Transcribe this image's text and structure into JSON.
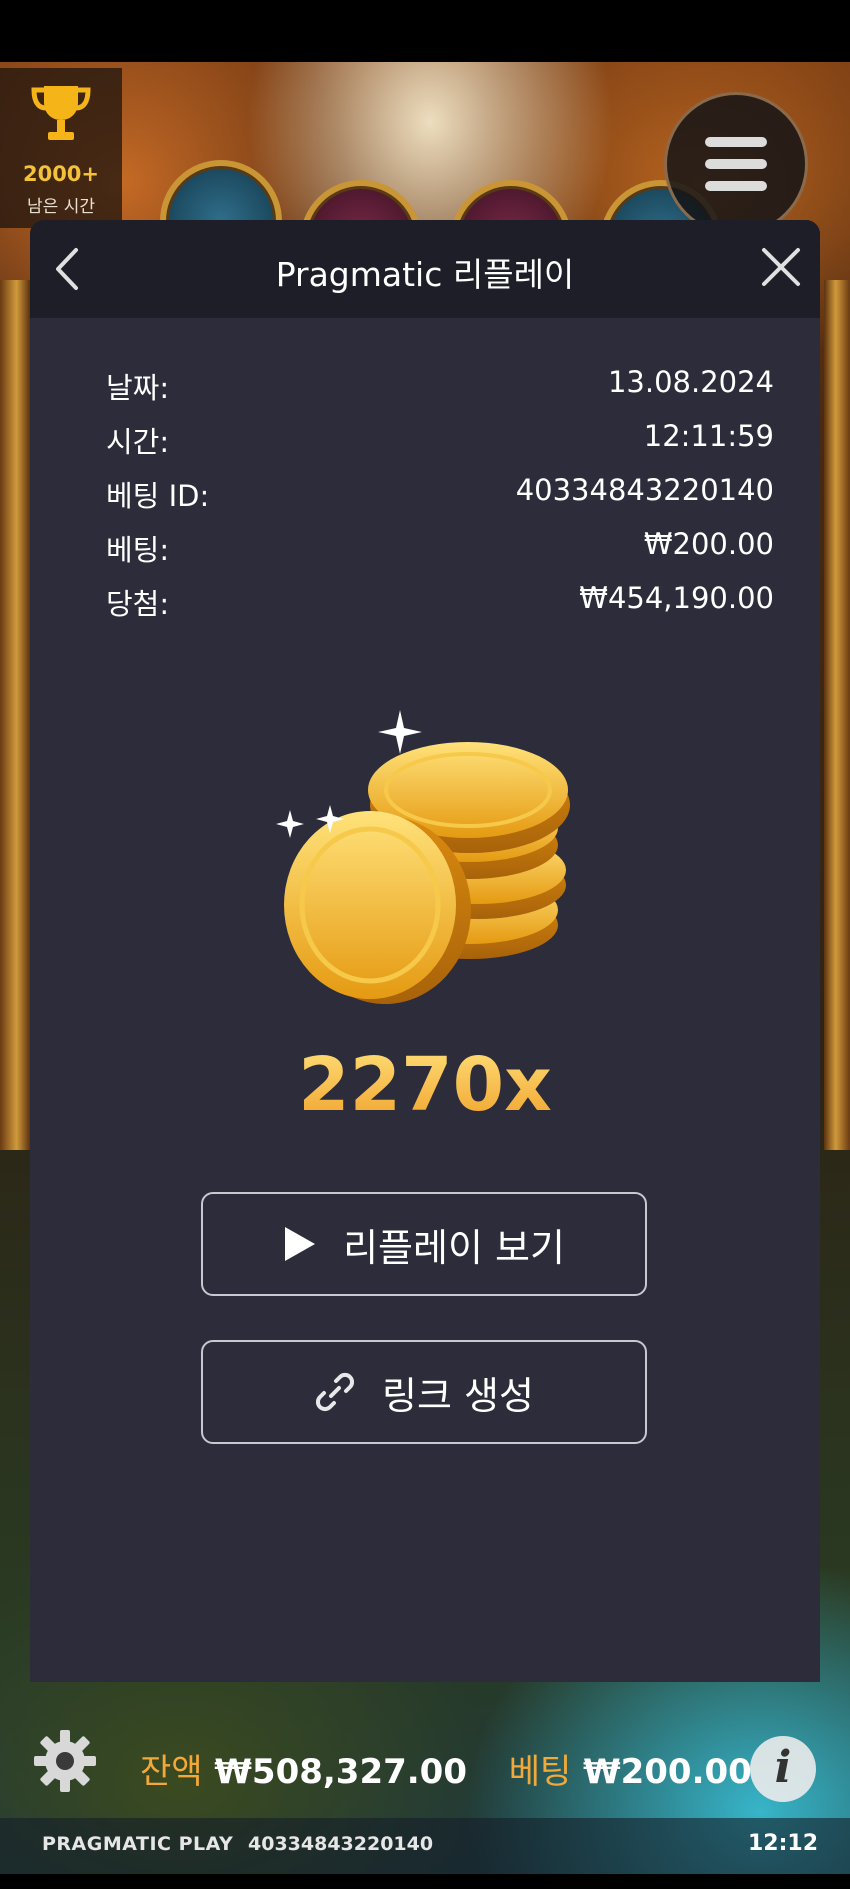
{
  "header": {
    "trophy_count": "2000+",
    "time_left_label": "남은 시간"
  },
  "modal": {
    "title": "Pragmatic 리플레이",
    "details": [
      {
        "label": "날짜:",
        "value": "13.08.2024"
      },
      {
        "label": "시간:",
        "value": "12:11:59"
      },
      {
        "label": "베팅 ID:",
        "value": "40334843220140"
      },
      {
        "label": "베팅:",
        "value": "₩200.00"
      },
      {
        "label": "당첨:",
        "value": "₩454,190.00"
      }
    ],
    "multiplier": "2270x",
    "watch_replay_label": "리플레이 보기",
    "create_link_label": "링크 생성"
  },
  "bottom_bar": {
    "balance_label": "잔액",
    "balance_value": "₩508,327.00",
    "bet_label": "베팅",
    "bet_value": "₩200.00"
  },
  "footer": {
    "brand": "PRAGMATIC PLAY",
    "bet_id": "40334843220140",
    "clock": "12:12"
  },
  "colors": {
    "modal_bg": "#2c2c3b",
    "header_bg": "#1d1e28",
    "accent_gold": "#f2a93a"
  }
}
